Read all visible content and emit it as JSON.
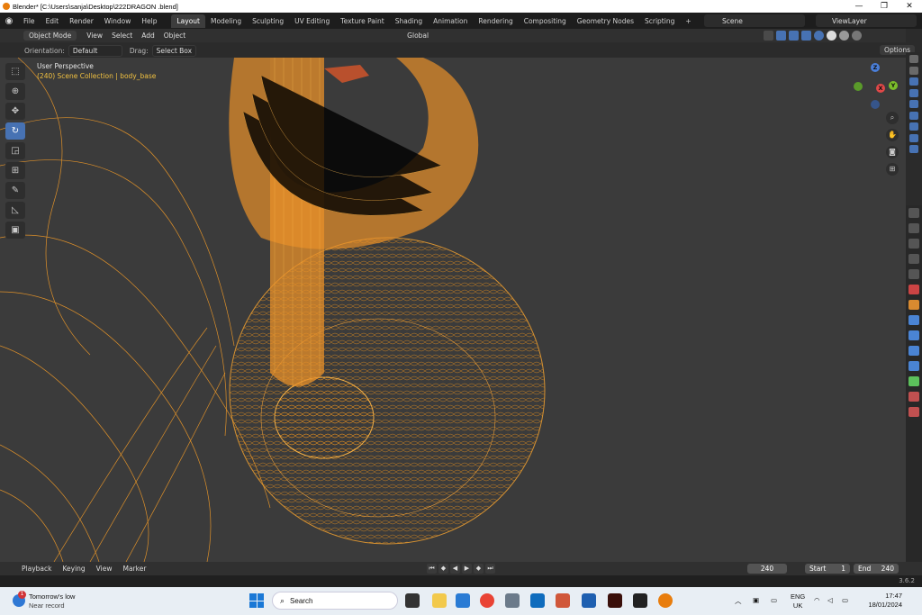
{
  "window": {
    "title": "Blender* [C:\\Users\\sanja\\Desktop\\222DRAGON .blend]",
    "controls": [
      "—",
      "❐",
      "✕"
    ]
  },
  "menu": {
    "items": [
      "File",
      "Edit",
      "Render",
      "Window",
      "Help"
    ]
  },
  "workspaces": [
    "Layout",
    "Modeling",
    "Sculpting",
    "UV Editing",
    "Texture Paint",
    "Shading",
    "Animation",
    "Rendering",
    "Compositing",
    "Geometry Nodes",
    "Scripting",
    "+"
  ],
  "scene": "Scene",
  "view_layer": "ViewLayer",
  "viewport_header": {
    "mode": "Object Mode",
    "menus": [
      "View",
      "Select",
      "Add",
      "Object"
    ],
    "transform": "Global"
  },
  "tool_settings": {
    "orientation_label": "Orientation:",
    "orientation_value": "Default",
    "drag_label": "Drag:",
    "drag_value": "Select Box",
    "options": "Options"
  },
  "viewport": {
    "perspective": "User Perspective",
    "collection_info": "(240) Scene Collection | body_base"
  },
  "gizmo": {
    "z": "Z",
    "y": "Y",
    "x": "X"
  },
  "timeline": {
    "menus": [
      "Playback",
      "Keying",
      "View",
      "Marker"
    ],
    "current_frame": "240",
    "start_label": "Start",
    "start": "1",
    "end_label": "End",
    "end": "240"
  },
  "status": {
    "version": "3.6.2"
  },
  "taskbar": {
    "weather_title": "Tomorrow's low",
    "weather_sub": "Near record",
    "weather_badge": "1",
    "search": "Search",
    "lang": "ENG",
    "region": "UK",
    "time": "17:47",
    "date": "18/01/2024"
  }
}
